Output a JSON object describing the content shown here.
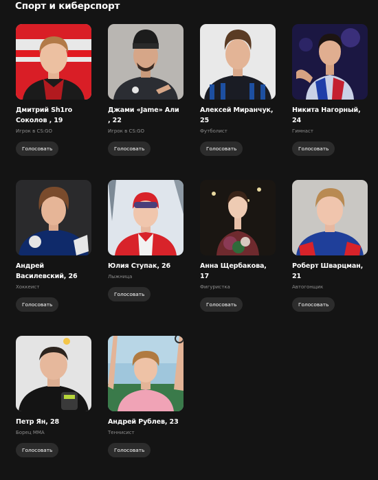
{
  "section": {
    "title": "Спорт и киберспорт"
  },
  "vote_label": "Голосовать",
  "people": [
    {
      "name": "Дмитрий Sh1ro Соколов , 19",
      "role": "Игрок в CS:GO",
      "photo": "photo-dmitry-sokolov"
    },
    {
      "name": "Джами «Jame» Али , 22",
      "role": "Игрок в CS:GO",
      "photo": "photo-jame-ali"
    },
    {
      "name": "Алексей Миранчук, 25",
      "role": "Футболист",
      "photo": "photo-aleksey-miranchuk"
    },
    {
      "name": "Никита Нагорный, 24",
      "role": "Гимнаст",
      "photo": "photo-nikita-nagorny"
    },
    {
      "name": "Андрей Василевский, 26",
      "role": "Хоккеист",
      "photo": "photo-andrey-vasilevsky"
    },
    {
      "name": "Юлия Ступак, 26",
      "role": "Лыжница",
      "photo": "photo-yulia-stupak"
    },
    {
      "name": "Анна Щербакова, 17",
      "role": "Фигуристка",
      "photo": "photo-anna-shcherbakova"
    },
    {
      "name": "Роберт Шварцман, 21",
      "role": "Автогонщик",
      "photo": "photo-robert-shvartsman"
    },
    {
      "name": "Петр Ян, 28",
      "role": "Борец ММА",
      "photo": "photo-petr-yan"
    },
    {
      "name": "Андрей Рублев, 23",
      "role": "Теннисист",
      "photo": "photo-andrey-rublev"
    }
  ]
}
